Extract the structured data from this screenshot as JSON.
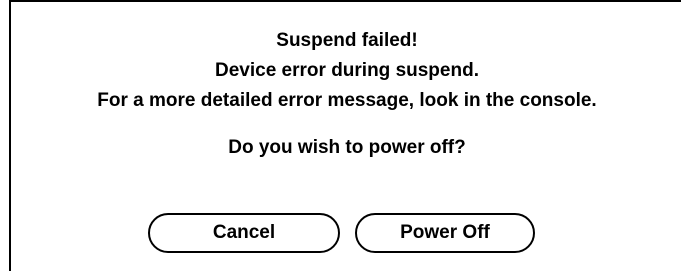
{
  "dialog": {
    "title": "Suspend failed!",
    "message_line1": "Device error during suspend.",
    "message_line2": "For a more detailed error message, look in the console.",
    "question": "Do you wish to power off?"
  },
  "buttons": {
    "cancel_label": "Cancel",
    "power_off_label": "Power Off"
  }
}
